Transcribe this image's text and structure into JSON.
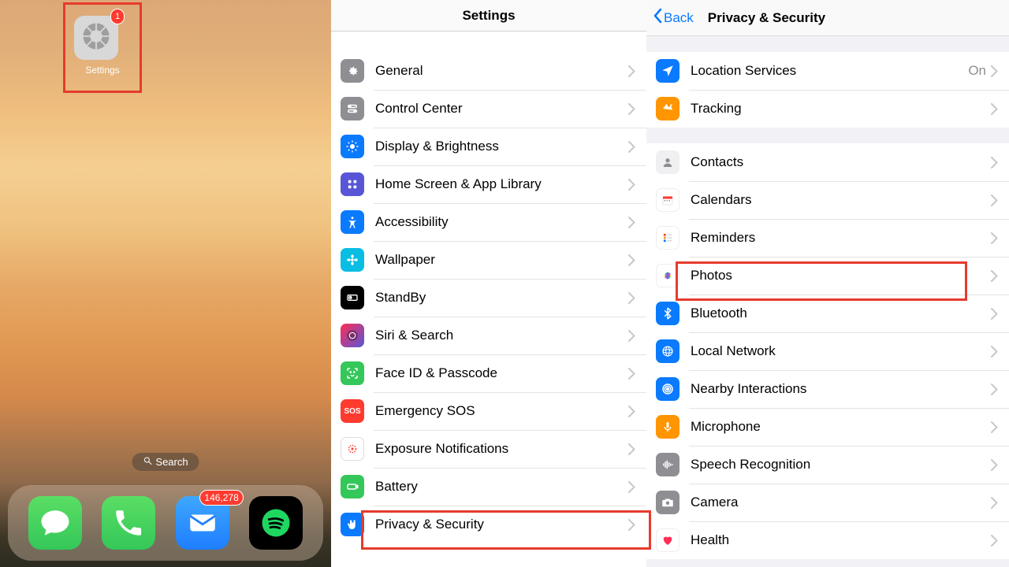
{
  "panel1": {
    "settings_app_label": "Settings",
    "settings_badge": "1",
    "search_label": "Search",
    "mail_badge": "146,278"
  },
  "panel2": {
    "title": "Settings",
    "items": [
      {
        "label": "General"
      },
      {
        "label": "Control Center"
      },
      {
        "label": "Display & Brightness"
      },
      {
        "label": "Home Screen & App Library"
      },
      {
        "label": "Accessibility"
      },
      {
        "label": "Wallpaper"
      },
      {
        "label": "StandBy"
      },
      {
        "label": "Siri & Search"
      },
      {
        "label": "Face ID & Passcode"
      },
      {
        "label": "Emergency SOS"
      },
      {
        "label": "Exposure Notifications"
      },
      {
        "label": "Battery"
      },
      {
        "label": "Privacy & Security"
      }
    ]
  },
  "panel3": {
    "back_label": "Back",
    "title": "Privacy & Security",
    "location_value": "On",
    "group1": [
      {
        "label": "Location Services"
      },
      {
        "label": "Tracking"
      }
    ],
    "group2": [
      {
        "label": "Contacts"
      },
      {
        "label": "Calendars"
      },
      {
        "label": "Reminders"
      },
      {
        "label": "Photos"
      },
      {
        "label": "Bluetooth"
      },
      {
        "label": "Local Network"
      },
      {
        "label": "Nearby Interactions"
      },
      {
        "label": "Microphone"
      },
      {
        "label": "Speech Recognition"
      },
      {
        "label": "Camera"
      },
      {
        "label": "Health"
      }
    ]
  }
}
